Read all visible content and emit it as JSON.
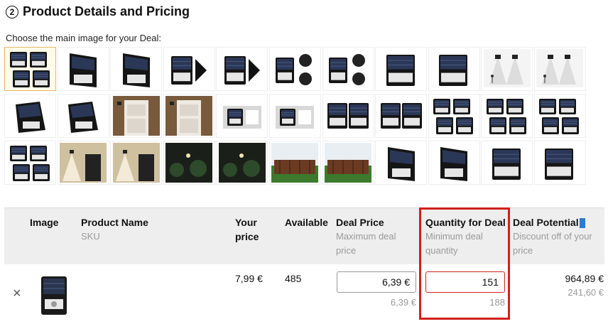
{
  "section": {
    "step_number": "2",
    "title": "Product Details and Pricing",
    "subtitle": "Choose the main image for your Deal:"
  },
  "images": {
    "selected_index": 0,
    "rows": [
      [
        "quad-lamps",
        "lamp-angle",
        "lamp-angle",
        "lamp-arrow",
        "lamp-arrow",
        "lamp-parts",
        "lamp-parts",
        "lamp-front",
        "lamp-front",
        "light-diagram",
        "light-diagram"
      ],
      [
        "lamp-side",
        "lamp-side",
        "door-scene",
        "door-scene",
        "lamp-pack",
        "lamp-pack",
        "double-lamp",
        "double-lamp",
        "quad-lamps",
        "quad-lamps",
        "quad-lamps"
      ],
      [
        "quad-lamps",
        "night-scene",
        "night-scene",
        "garden-night",
        "garden-night",
        "fence-scene",
        "fence-scene",
        "lamp-angle",
        "lamp-angle",
        "lamp-front",
        "lamp-front"
      ]
    ]
  },
  "table": {
    "headers": {
      "image": "Image",
      "product_name": "Product Name",
      "sku": "SKU",
      "your_price": "Your price",
      "available": "Available",
      "deal_price": "Deal Price",
      "deal_price_sub": "Maximum deal price",
      "quantity": "Quantity for Deal",
      "quantity_sub": "Minimum deal quantity",
      "potential": "Deal Potential",
      "potential_sub": "Discount off of your price"
    },
    "row": {
      "remove": "×",
      "your_price": "7,99 €",
      "available": "485",
      "deal_price_value": "6,39 €",
      "deal_price_max": "6,39 €",
      "quantity_value": "151",
      "quantity_min": "188",
      "potential": "964,89 €",
      "discount": "241,60 €"
    }
  },
  "colors": {
    "highlight": "#d0211c",
    "header_bg": "#eeeeee"
  }
}
